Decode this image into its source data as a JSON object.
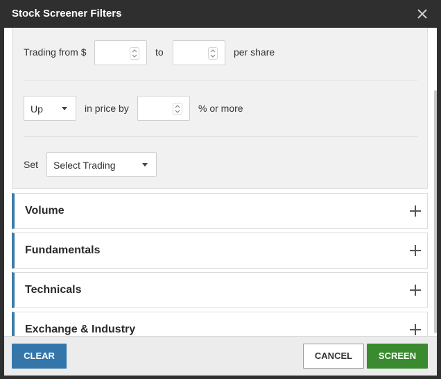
{
  "dialog": {
    "title": "Stock Screener Filters",
    "close_icon": "close-icon"
  },
  "trading": {
    "from_label": "Trading from $",
    "from_value": "",
    "to_label": "to",
    "to_value": "",
    "per_share_label": "per share",
    "direction_value": "Up",
    "in_price_by_label": "in price by",
    "percent_value": "",
    "percent_suffix": "% or more",
    "set_label": "Set",
    "set_select_value": "Select Trading"
  },
  "sections": [
    {
      "label": "Volume"
    },
    {
      "label": "Fundamentals"
    },
    {
      "label": "Technicals"
    },
    {
      "label": "Exchange & Industry"
    }
  ],
  "footer": {
    "clear_label": "CLEAR",
    "cancel_label": "CANCEL",
    "screen_label": "SCREEN"
  },
  "colors": {
    "accent_blue": "#3476aa",
    "screen_green": "#3a8a30",
    "section_border": "#3b7ca8"
  }
}
